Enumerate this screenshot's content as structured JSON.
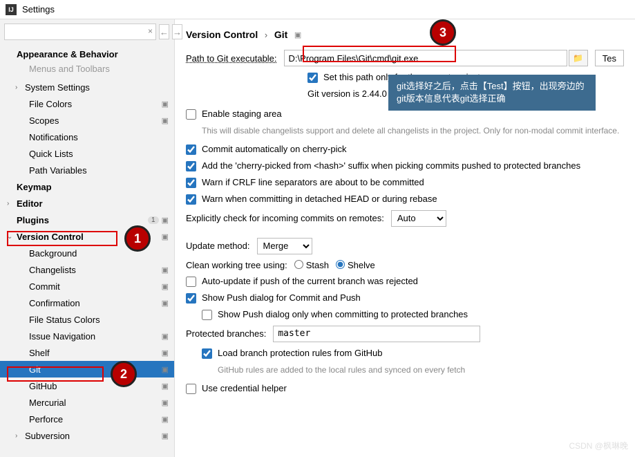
{
  "window": {
    "title": "Settings",
    "logo": "IJ"
  },
  "search": {
    "placeholder": ""
  },
  "nav": {
    "back": "←",
    "fwd": "→"
  },
  "tree": [
    {
      "label": "Appearance & Behavior",
      "bold": true,
      "chev": "",
      "indent": 0,
      "proj": false
    },
    {
      "label": "Menus and Toolbars",
      "bold": false,
      "chev": "",
      "indent": 1,
      "proj": false,
      "dim": true
    },
    {
      "label": "System Settings",
      "bold": false,
      "chev": "›",
      "indent": 0,
      "proj": false,
      "pad": true
    },
    {
      "label": "File Colors",
      "bold": false,
      "chev": "",
      "indent": 1,
      "proj": true
    },
    {
      "label": "Scopes",
      "bold": false,
      "chev": "",
      "indent": 1,
      "proj": true
    },
    {
      "label": "Notifications",
      "bold": false,
      "chev": "",
      "indent": 1,
      "proj": false
    },
    {
      "label": "Quick Lists",
      "bold": false,
      "chev": "",
      "indent": 1,
      "proj": false
    },
    {
      "label": "Path Variables",
      "bold": false,
      "chev": "",
      "indent": 1,
      "proj": false
    },
    {
      "label": "Keymap",
      "bold": true,
      "chev": "",
      "indent": 0,
      "proj": false
    },
    {
      "label": "Editor",
      "bold": true,
      "chev": "›",
      "indent": 0,
      "proj": false
    },
    {
      "label": "Plugins",
      "bold": true,
      "chev": "",
      "indent": 0,
      "proj": true,
      "badge": "1"
    },
    {
      "label": "Version Control",
      "bold": true,
      "chev": "⌄",
      "indent": 0,
      "proj": true
    },
    {
      "label": "Background",
      "bold": false,
      "chev": "",
      "indent": 1,
      "proj": false
    },
    {
      "label": "Changelists",
      "bold": false,
      "chev": "",
      "indent": 1,
      "proj": true
    },
    {
      "label": "Commit",
      "bold": false,
      "chev": "",
      "indent": 1,
      "proj": true
    },
    {
      "label": "Confirmation",
      "bold": false,
      "chev": "",
      "indent": 1,
      "proj": true
    },
    {
      "label": "File Status Colors",
      "bold": false,
      "chev": "",
      "indent": 1,
      "proj": false
    },
    {
      "label": "Issue Navigation",
      "bold": false,
      "chev": "",
      "indent": 1,
      "proj": true
    },
    {
      "label": "Shelf",
      "bold": false,
      "chev": "",
      "indent": 1,
      "proj": true
    },
    {
      "label": "Git",
      "bold": false,
      "chev": "",
      "indent": 1,
      "proj": true,
      "selected": true
    },
    {
      "label": "GitHub",
      "bold": false,
      "chev": "",
      "indent": 1,
      "proj": true
    },
    {
      "label": "Mercurial",
      "bold": false,
      "chev": "",
      "indent": 1,
      "proj": true
    },
    {
      "label": "Perforce",
      "bold": false,
      "chev": "",
      "indent": 1,
      "proj": true
    },
    {
      "label": "Subversion",
      "bold": false,
      "chev": "›",
      "indent": 0,
      "proj": true,
      "pad": true
    }
  ],
  "breadcrumb": {
    "a": "Version Control",
    "sep": "›",
    "b": "Git"
  },
  "form": {
    "path_label": "Path to Git executable:",
    "path_value": "D:\\Program Files\\Git\\cmd\\git.exe",
    "test_label": "Tes",
    "set_path_project": "Set this path only for the current project",
    "git_version": "Git version is 2.44.0",
    "enable_staging": "Enable staging area",
    "enable_staging_hint": "This will disable changelists support and delete all changelists in the project. Only for non-modal commit interface.",
    "commit_cherry": "Commit automatically on cherry-pick",
    "add_suffix": "Add the 'cherry-picked from <hash>' suffix when picking commits pushed to protected branches",
    "warn_crlf": "Warn if CRLF line separators are about to be committed",
    "warn_detached": "Warn when committing in detached HEAD or during rebase",
    "explicit_check": "Explicitly check for incoming commits on remotes:",
    "explicit_value": "Auto",
    "update_method": "Update method:",
    "update_value": "Merge",
    "clean_tree": "Clean working tree using:",
    "stash": "Stash",
    "shelve": "Shelve",
    "auto_update": "Auto-update if push of the current branch was rejected",
    "show_push": "Show Push dialog for Commit and Push",
    "show_push_protected": "Show Push dialog only when committing to protected branches",
    "protected_label": "Protected branches:",
    "protected_value": "master",
    "load_rules": "Load branch protection rules from GitHub",
    "load_rules_hint": "GitHub rules are added to the local rules and synced on every fetch",
    "cred_helper": "Use credential helper"
  },
  "tooltip": "git选择好之后，点击【Test】按钮，出现旁边的git版本信息代表git选择正确",
  "callouts": {
    "c1": "1",
    "c2": "2",
    "c3": "3"
  },
  "watermark": "CSDN @枫琳晚"
}
